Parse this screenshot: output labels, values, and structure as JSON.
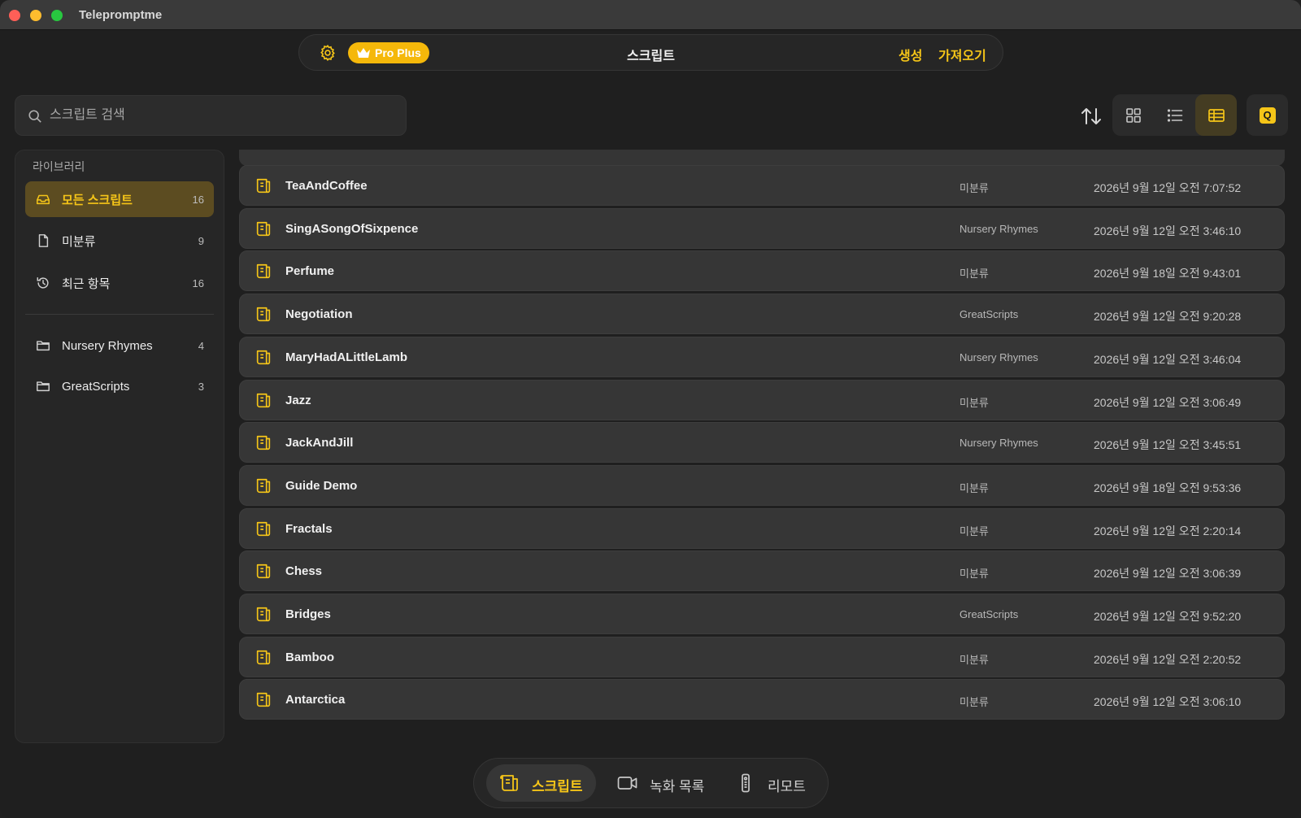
{
  "app": {
    "title": "Telepromptme"
  },
  "toolbar": {
    "pro_label": "Pro Plus",
    "title": "스크립트",
    "create_label": "생성",
    "import_label": "가져오기"
  },
  "search": {
    "placeholder": "스크립트 검색",
    "value": ""
  },
  "view_modes": {
    "active": "table"
  },
  "sidebar": {
    "heading": "라이브러리",
    "items": [
      {
        "label": "모든 스크립트",
        "count": "16",
        "icon": "tray-icon",
        "active": true
      },
      {
        "label": "미분류",
        "count": "9",
        "icon": "document-icon"
      },
      {
        "label": "최근 항목",
        "count": "16",
        "icon": "history-icon"
      }
    ],
    "folders": [
      {
        "label": "Nursery Rhymes",
        "count": "4",
        "icon": "folder-icon"
      },
      {
        "label": "GreatScripts",
        "count": "3",
        "icon": "folder-icon"
      }
    ]
  },
  "scripts": [
    {
      "name": "TeaAndCoffee",
      "folder": "미분류",
      "date": "2026년 9월 12일 오전 7:07:52"
    },
    {
      "name": "SingASongOfSixpence",
      "folder": "Nursery Rhymes",
      "date": "2026년 9월 12일 오전 3:46:10"
    },
    {
      "name": "Perfume",
      "folder": "미분류",
      "date": "2026년 9월 18일 오전 9:43:01"
    },
    {
      "name": "Negotiation",
      "folder": "GreatScripts",
      "date": "2026년 9월 12일 오전 9:20:28"
    },
    {
      "name": "MaryHadALittleLamb",
      "folder": "Nursery Rhymes",
      "date": "2026년 9월 12일 오전 3:46:04"
    },
    {
      "name": "Jazz",
      "folder": "미분류",
      "date": "2026년 9월 12일 오전 3:06:49"
    },
    {
      "name": "JackAndJill",
      "folder": "Nursery Rhymes",
      "date": "2026년 9월 12일 오전 3:45:51"
    },
    {
      "name": "Guide Demo",
      "folder": "미분류",
      "date": "2026년 9월 18일 오전 9:53:36"
    },
    {
      "name": "Fractals",
      "folder": "미분류",
      "date": "2026년 9월 12일 오전 2:20:14"
    },
    {
      "name": "Chess",
      "folder": "미분류",
      "date": "2026년 9월 12일 오전 3:06:39"
    },
    {
      "name": "Bridges",
      "folder": "GreatScripts",
      "date": "2026년 9월 12일 오전 9:52:20"
    },
    {
      "name": "Bamboo",
      "folder": "미분류",
      "date": "2026년 9월 12일 오전 2:20:52"
    },
    {
      "name": "Antarctica",
      "folder": "미분류",
      "date": "2026년 9월 12일 오전 3:06:10"
    }
  ],
  "bottom_nav": [
    {
      "label": "스크립트",
      "icon": "script-icon",
      "active": true
    },
    {
      "label": "녹화 목록",
      "icon": "video-camera-icon"
    },
    {
      "label": "리모트",
      "icon": "remote-icon"
    }
  ],
  "colors": {
    "accent": "#f5c518",
    "background": "#1f1f1f",
    "row": "#363636"
  }
}
